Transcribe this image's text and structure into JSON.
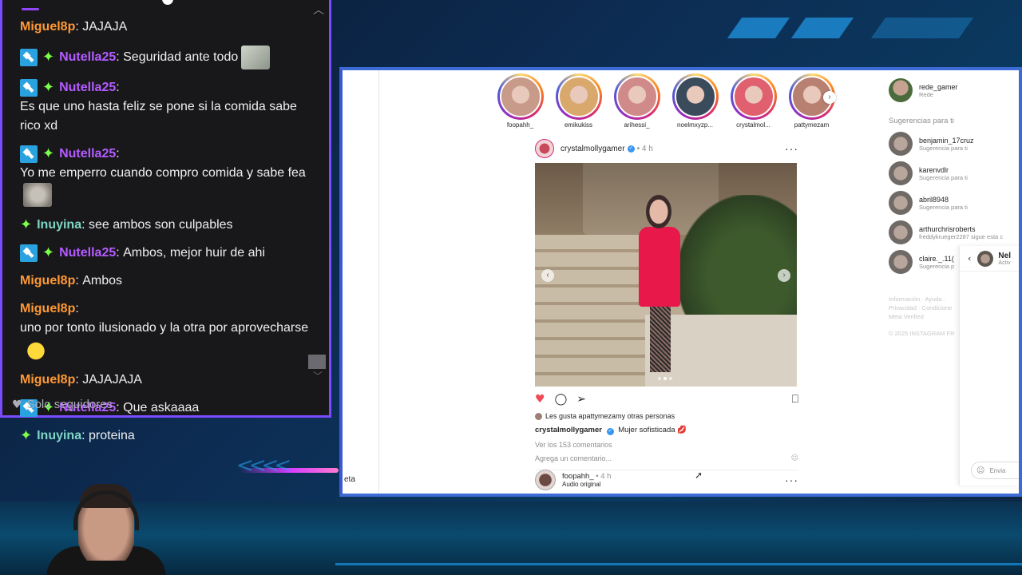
{
  "chat": {
    "messages": [
      {
        "badges": [],
        "user": "Miguel8p",
        "user_color": "orange",
        "text": "JAJAJA",
        "emote": ""
      },
      {
        "badges": [
          "mod",
          "star"
        ],
        "user": "Nutella25",
        "user_color": "purple",
        "text": "Seguridad ante todo",
        "emote": "a"
      },
      {
        "badges": [
          "mod",
          "star"
        ],
        "user": "Nutella25",
        "user_color": "purple",
        "text": "Es que uno hasta feliz se pone si la comida sabe rico xd",
        "emote": ""
      },
      {
        "badges": [
          "mod",
          "star"
        ],
        "user": "Nutella25",
        "user_color": "purple",
        "text": "Yo me emperro cuando compro comida y sabe fea",
        "emote": "b"
      },
      {
        "badges": [
          "star"
        ],
        "user": "Inuyina",
        "user_color": "teal",
        "text": "see ambos son culpables",
        "emote": ""
      },
      {
        "badges": [
          "mod",
          "star"
        ],
        "user": "Nutella25",
        "user_color": "purple",
        "text": "Ambos, mejor huir de ahi",
        "emote": ""
      },
      {
        "badges": [],
        "user": "Miguel8p",
        "user_color": "orange",
        "text": "Ambos",
        "emote": ""
      },
      {
        "badges": [],
        "user": "Miguel8p",
        "user_color": "orange",
        "text": "uno por tonto ilusionado y la otra por aprovecharse",
        "emote": "c"
      },
      {
        "badges": [],
        "user": "Miguel8p",
        "user_color": "orange",
        "text": "JAJAJAJA",
        "emote": ""
      },
      {
        "badges": [
          "mod",
          "star"
        ],
        "user": "Nutella25",
        "user_color": "purple",
        "text": "Que askaaaa",
        "emote": ""
      },
      {
        "badges": [
          "star"
        ],
        "user": "Inuyina",
        "user_color": "teal",
        "text": "proteina",
        "emote": ""
      }
    ],
    "footer_label": "Solo seguidores",
    "separator": ": "
  },
  "instagram": {
    "sidebar_label": "eta",
    "stories": [
      {
        "name": "foopahh_",
        "color": "#c79a8a"
      },
      {
        "name": "emikukiss",
        "color": "#d9a86c"
      },
      {
        "name": "arihessi_",
        "color": "#d08a8a"
      },
      {
        "name": "noelmxyzp...",
        "color": "#3a4b5c"
      },
      {
        "name": "crystalmol...",
        "color": "#e06070"
      },
      {
        "name": "pattymezam",
        "color": "#b88070"
      }
    ],
    "post": {
      "username": "crystalmollygamer",
      "time": "• 4 h",
      "likes_text": "Les gusta a ",
      "likes_user": "pattymezam",
      "likes_rest": " y otras personas",
      "caption_user": "crystalmollygamer",
      "caption_text": "Mujer sofisticada 💋",
      "comments_link": "Ver los 153 comentarios",
      "add_comment": "Agrega un comentario..."
    },
    "next_post": {
      "username": "foopahh_",
      "time": "• 4 h",
      "subtitle": "Audio original"
    },
    "me": {
      "username": "rede_gamer",
      "subtitle": "Rede"
    },
    "suggestions_title": "Sugerencias para ti",
    "suggestions": [
      {
        "name": "benjamin_17cruz",
        "sub": "Sugerencia para ti"
      },
      {
        "name": "karenvdlr",
        "sub": "Sugerencia para ti"
      },
      {
        "name": "abril8948",
        "sub": "Sugerencia para ti"
      },
      {
        "name": "arthurchrisroberts",
        "sub": "freddykrueger2287 sigue esta c"
      },
      {
        "name": "claire._.11(",
        "sub": "Sugerencia p"
      }
    ],
    "footer_links": "Información · Ayuda · Privacidad · Condicione Meta Verified",
    "copyright": "© 2025 INSTAGRAM FR",
    "dm": {
      "name": "Nel",
      "status": "Activ",
      "input_placeholder": "Envia"
    }
  }
}
